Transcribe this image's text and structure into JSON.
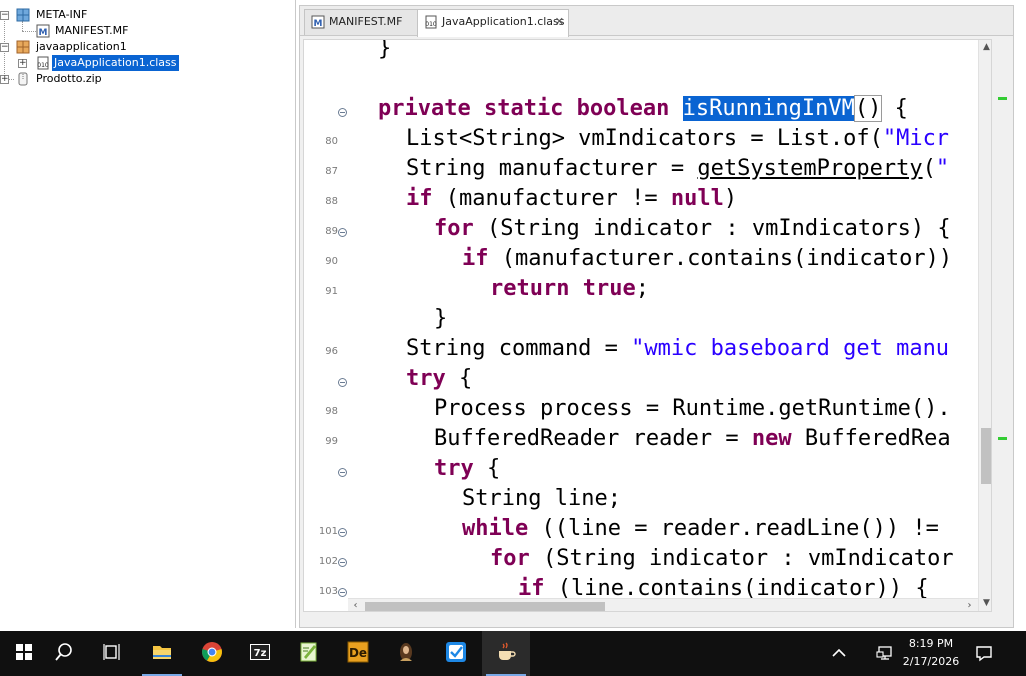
{
  "tree": {
    "items": [
      {
        "label": "META-INF",
        "expander": "−"
      },
      {
        "label": "MANIFEST.MF"
      },
      {
        "label": "javaapplication1",
        "expander": "−"
      },
      {
        "label": "JavaApplication1.class",
        "expander": "+"
      },
      {
        "label": "Prodotto.zip",
        "expander": "+"
      }
    ]
  },
  "editor": {
    "tabs": [
      {
        "label": "MANIFEST.MF",
        "close": ""
      },
      {
        "label": "JavaApplication1.class",
        "close": "✕"
      }
    ]
  },
  "code": {
    "line_numbers": [
      "80",
      "87",
      "88",
      "89",
      "90",
      "91",
      "96",
      "98",
      "99",
      "101",
      "102",
      "103"
    ],
    "tokens": {
      "l0_a": "}",
      "l1_kw": "private static boolean",
      "l1_sp": " ",
      "l1_sel": "isRunningInVM",
      "l1_paren": "()",
      "l1_b": " {",
      "l2_a": "List<String> vmIndicators = List.of(",
      "l2_s": "\"Micr",
      "l3_a": "String manufacturer = ",
      "l3_u": "getSystemProperty",
      "l3_b": "(",
      "l3_s": "\"",
      "l4_kw": "if",
      "l4_a": " (manufacturer != ",
      "l4_kw2": "null",
      "l4_b": ")",
      "l5_kw": "for",
      "l5_a": " (String indicator : vmIndicators) {",
      "l6_kw": "if",
      "l6_a": " (manufacturer.contains(indicator))",
      "l7_kw": "return true",
      "l7_a": ";",
      "l8_a": "}",
      "l9_a": "String command = ",
      "l9_s": "\"wmic baseboard get manu",
      "l10_kw": "try",
      "l10_a": " {",
      "l11_a": "Process process = Runtime.getRuntime().",
      "l12_a": "BufferedReader reader = ",
      "l12_kw": "new",
      "l12_b": " BufferedRea",
      "l13_kw": "try",
      "l13_a": " {",
      "l14_a": "String line;",
      "l15_kw": "while",
      "l15_a": " ((line = reader.readLine()) != ",
      "l16_kw": "for",
      "l16_a": " (String indicator : vmIndicator",
      "l17_kw": "if",
      "l17_a": " (line.contains(indicator)) {"
    }
  },
  "taskbar": {
    "time": "8:19 PM",
    "date": "2/17/2026",
    "apps": [
      "start",
      "search",
      "task-view",
      "file-explorer",
      "chrome",
      "7zip",
      "notepad-plus",
      "decompiler",
      "portrait-app",
      "todo",
      "java-app"
    ]
  },
  "colors": {
    "keyword": "#7f0055",
    "string": "#2a00ff",
    "selection": "#0a64d2",
    "taskbar": "#101010"
  }
}
